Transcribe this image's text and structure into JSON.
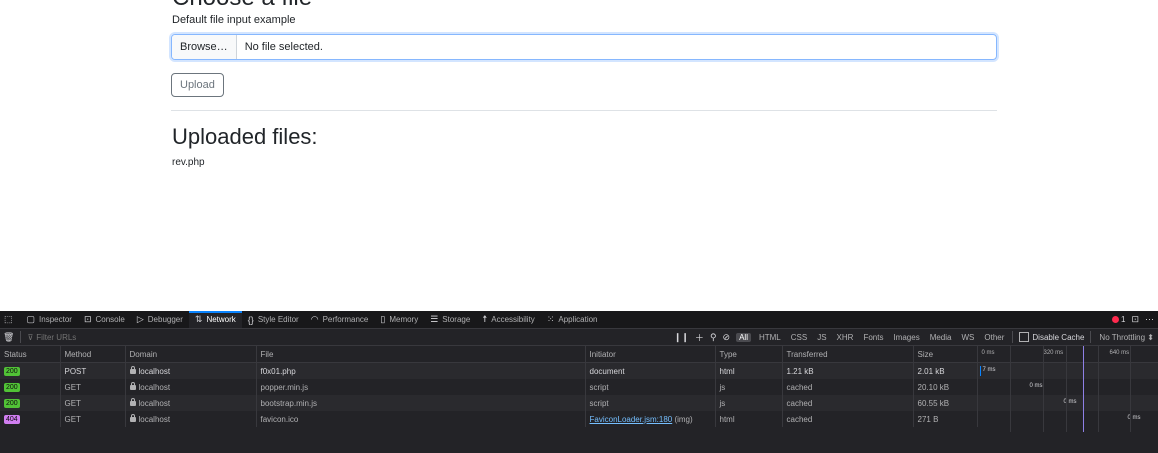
{
  "page": {
    "heading": "Choose a file",
    "input_label": "Default file input example",
    "browse_label": "Browse…",
    "file_status": "No file selected.",
    "upload_label": "Upload",
    "uploaded_title": "Uploaded files:",
    "uploaded_file": "rev.php"
  },
  "devtools": {
    "tabs": [
      {
        "label": "Inspector",
        "icon": "inspector-icon"
      },
      {
        "label": "Console",
        "icon": "console-icon"
      },
      {
        "label": "Debugger",
        "icon": "debugger-icon"
      },
      {
        "label": "Network",
        "icon": "network-icon"
      },
      {
        "label": "Style Editor",
        "icon": "style-editor-icon"
      },
      {
        "label": "Performance",
        "icon": "performance-icon"
      },
      {
        "label": "Memory",
        "icon": "memory-icon"
      },
      {
        "label": "Storage",
        "icon": "storage-icon"
      },
      {
        "label": "Accessibility",
        "icon": "accessibility-icon"
      },
      {
        "label": "Application",
        "icon": "application-icon"
      }
    ],
    "active_tab": "Network",
    "error_count": "1",
    "filter_placeholder": "Filter URLs",
    "filters": [
      "All",
      "HTML",
      "CSS",
      "JS",
      "XHR",
      "Fonts",
      "Images",
      "Media",
      "WS",
      "Other"
    ],
    "active_filter": "All",
    "disable_cache_label": "Disable Cache",
    "throttling_label": "No Throttling ⬍",
    "columns": [
      "Status",
      "Method",
      "Domain",
      "File",
      "Initiator",
      "Type",
      "Transferred",
      "Size"
    ],
    "waterfall_ticks": [
      "0 ms",
      "320 ms",
      "640 ms"
    ],
    "requests": [
      {
        "status": "200",
        "method": "POST",
        "domain": "localhost",
        "file": "f0x01.php",
        "initiator": "document",
        "initiator_extra": "",
        "type": "html",
        "transferred": "1.21 kB",
        "size": "2.01 kB",
        "timing": "7 ms"
      },
      {
        "status": "200",
        "method": "GET",
        "domain": "localhost",
        "file": "popper.min.js",
        "initiator": "script",
        "initiator_extra": "",
        "type": "js",
        "transferred": "cached",
        "size": "20.10 kB",
        "timing": "0 ms"
      },
      {
        "status": "200",
        "method": "GET",
        "domain": "localhost",
        "file": "bootstrap.min.js",
        "initiator": "script",
        "initiator_extra": "",
        "type": "js",
        "transferred": "cached",
        "size": "60.55 kB",
        "timing": "0 ms"
      },
      {
        "status": "404",
        "method": "GET",
        "domain": "localhost",
        "file": "favicon.ico",
        "initiator": "FaviconLoader.jsm:180",
        "initiator_extra": " (img)",
        "type": "html",
        "transferred": "cached",
        "size": "271 B",
        "timing": "0 ms"
      }
    ],
    "colors": {
      "status_ok": "#51c236",
      "status_not_found": "#d07ef0",
      "active_tab_accent": "#0a84ff"
    }
  }
}
